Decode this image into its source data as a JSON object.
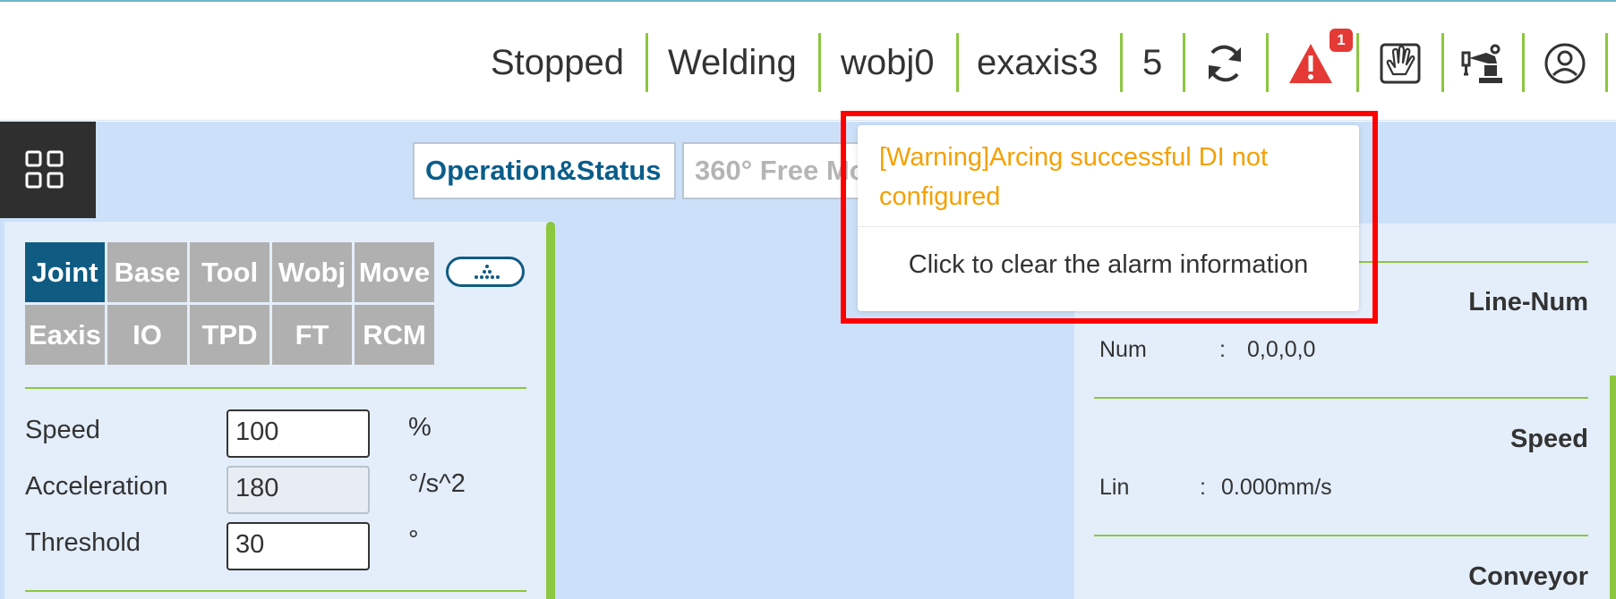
{
  "status_bar": {
    "state": "Stopped",
    "mode": "Welding",
    "wobj": "wobj0",
    "exaxis": "exaxis3",
    "number": "5",
    "alarm_count": "1",
    "icons": [
      "refresh-icon",
      "alarm-warning-icon",
      "hand-guide-icon",
      "robot-arm-icon",
      "user-icon"
    ],
    "accent_color": "#8dc63f"
  },
  "tabs": [
    {
      "label": "Operation&Status",
      "active": true
    },
    {
      "label": "360° Free Mo",
      "active": false
    }
  ],
  "jog_buttons": [
    {
      "label": "Joint",
      "selected": true
    },
    {
      "label": "Base",
      "selected": false
    },
    {
      "label": "Tool",
      "selected": false
    },
    {
      "label": "Wobj",
      "selected": false
    },
    {
      "label": "Move",
      "selected": false
    },
    {
      "label": "Eaxis",
      "selected": false
    },
    {
      "label": "IO",
      "selected": false
    },
    {
      "label": "TPD",
      "selected": false
    },
    {
      "label": "FT",
      "selected": false
    },
    {
      "label": "RCM",
      "selected": false
    }
  ],
  "params": {
    "speed": {
      "label": "Speed",
      "value": "100",
      "unit": "%"
    },
    "acceleration": {
      "label": "Acceleration",
      "value": "180",
      "unit": "°/s^2"
    },
    "threshold": {
      "label": "Threshold",
      "value": "30",
      "unit": "°"
    }
  },
  "right_panel": {
    "line_num": {
      "title": "Line-Num",
      "key": "Num",
      "value": "0,0,0,0"
    },
    "speed": {
      "title": "Speed",
      "key": "Lin",
      "value": "0.000mm/s"
    },
    "conveyor": {
      "title": "Conveyor"
    }
  },
  "alarm_popup": {
    "warning": "[Warning]Arcing successful DI not configured",
    "clear": "Click to clear the alarm information",
    "warning_color": "#f5a000",
    "highlight_color": "#ff0000"
  }
}
